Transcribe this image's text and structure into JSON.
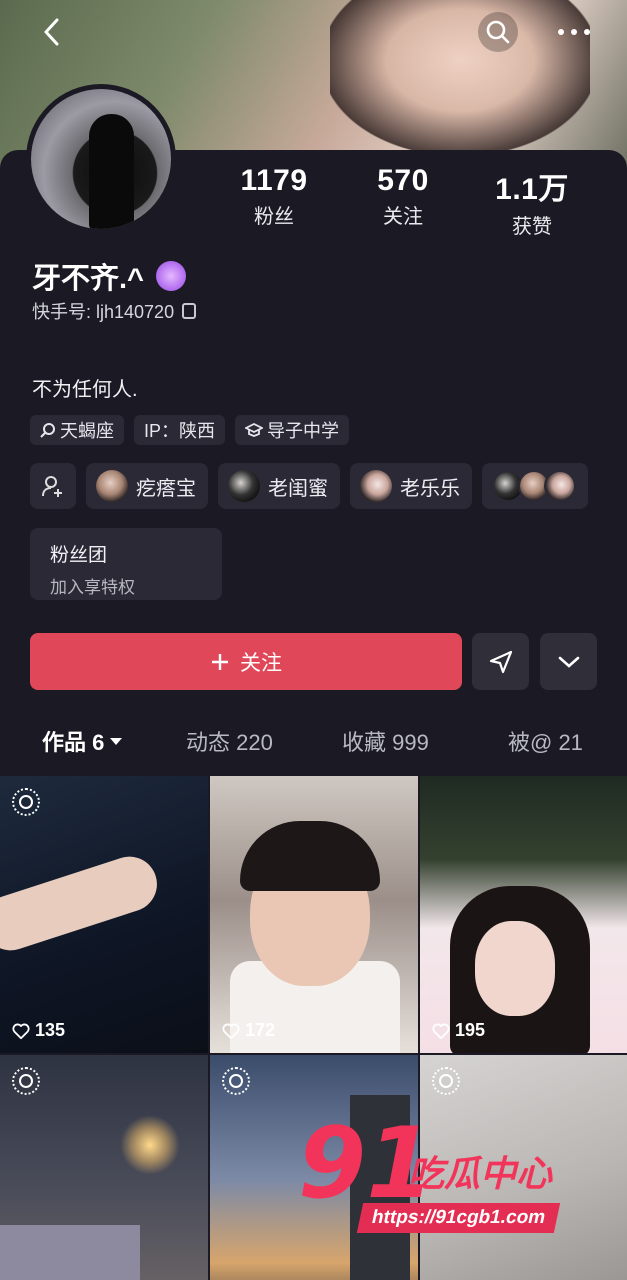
{
  "stats": [
    {
      "value": "1179",
      "label": "粉丝"
    },
    {
      "value": "570",
      "label": "关注"
    },
    {
      "value": "1.1万",
      "label": "获赞"
    }
  ],
  "profile": {
    "name": "牙不齐.^",
    "id_label": "快手号: ljh140720",
    "bio": "不为任何人."
  },
  "tags": [
    "天蝎座",
    "IP：陕西",
    "导子中学"
  ],
  "friends": [
    "疙瘩宝",
    "老闺蜜",
    "老乐乐"
  ],
  "fan_club": {
    "title": "粉丝团",
    "subtitle": "加入享特权"
  },
  "actions": {
    "follow": "关注"
  },
  "tabs": [
    {
      "label": "作品 6",
      "active": true
    },
    {
      "label": "动态 220",
      "active": false
    },
    {
      "label": "收藏 999",
      "active": false
    },
    {
      "label": "被@ 21",
      "active": false
    }
  ],
  "videos": [
    {
      "likes": "135"
    },
    {
      "likes": "172"
    },
    {
      "likes": "195"
    },
    {
      "likes": ""
    },
    {
      "likes": ""
    },
    {
      "likes": ""
    }
  ],
  "watermark": {
    "digits": "91",
    "brand": "吃瓜中心",
    "url": "https://91cgb1.com"
  },
  "icons": [
    "back-icon",
    "search-icon",
    "more-icon",
    "copy-icon",
    "search-tag-icon",
    "school-icon",
    "add-friend-icon",
    "plus-icon",
    "share-icon",
    "chevron-down-icon",
    "heart-icon",
    "live-icon"
  ],
  "colors": {
    "background": "#1b1a24",
    "card": "#2a2935",
    "follow": "#e0485a",
    "badge": "#b673f1"
  }
}
